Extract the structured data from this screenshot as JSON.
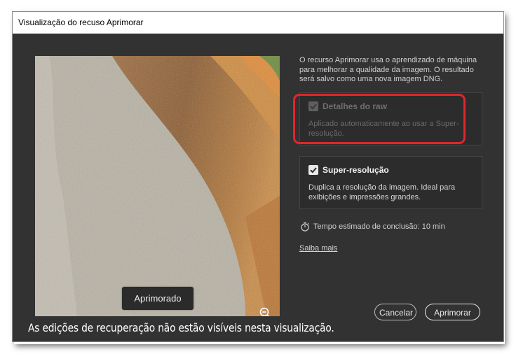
{
  "window": {
    "title": "Visualização do recuso Aprimorar"
  },
  "preview": {
    "label": "Aprimorado",
    "zoom_icon": "zoom-out-icon"
  },
  "caption": "As edições de recuperação não estão  visíveis nesta visualização.",
  "description": "O recurso Aprimorar usa o aprendizado de máquina para melhorar a qualidade da imagem. O resultado será salvo como uma nova imagem DNG.",
  "options": {
    "raw_details": {
      "title": "Detalhes do raw",
      "body": "Aplicado automaticamente ao usar a Super-resolução.",
      "checked": true,
      "disabled": true
    },
    "super_resolution": {
      "title": "Super-resolução",
      "body": "Duplica a resolução da imagem. Ideal para exibições e impressões grandes.",
      "checked": true,
      "disabled": false
    }
  },
  "estimate": {
    "text": "Tempo estimado de conclusão: 10 min",
    "icon": "stopwatch-icon"
  },
  "learn_more": "Saiba mais",
  "buttons": {
    "cancel": "Cancelar",
    "enhance": "Aprimorar"
  },
  "colors": {
    "highlight": "#e0262c",
    "dialog_bg": "#323232"
  }
}
